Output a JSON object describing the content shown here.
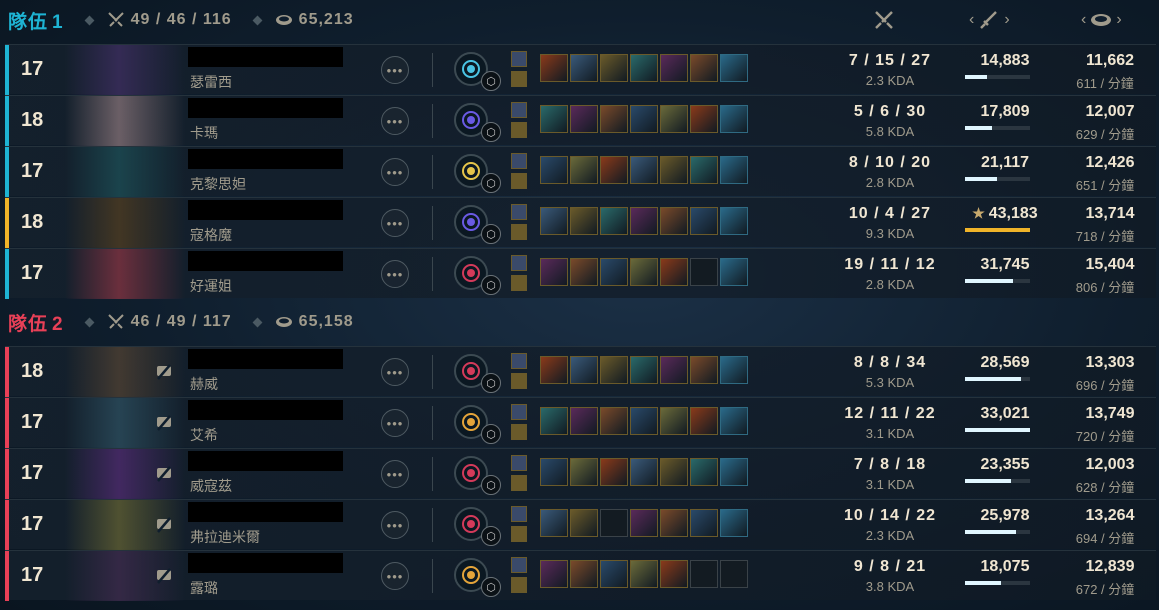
{
  "columns": {
    "kda_icon": "crossed-swords-icon",
    "damage_icon": "sword-icon",
    "gold_icon": "gold-coins-icon",
    "prev_arrow": "‹",
    "next_arrow": "›"
  },
  "colors": {
    "team1": "#1eb4d4",
    "team2": "#e84057",
    "highlight": "#f0b429",
    "damage_bar": "#e0f6ff"
  },
  "team1": {
    "label": "隊伍",
    "number": "1",
    "kills": "49 / 46 / 116",
    "gold": "65,213",
    "players": [
      {
        "level": "17",
        "champion": "瑟雷西",
        "kda": "7 / 15 / 27",
        "kda_ratio": "2.3 KDA",
        "damage": "14,883",
        "damage_fraction": 0.34,
        "gold": "11,662",
        "gpm": "611 / 分鐘",
        "keystone": "glacial-augment-icon",
        "secondary": "resolve-icon",
        "highlight": false,
        "portrait_color": "#3a2d5c",
        "items": [
          "item",
          "item",
          "item",
          "item",
          "item",
          "item",
          "trinket"
        ]
      },
      {
        "level": "18",
        "champion": "卡瑪",
        "kda": "5 / 6 / 30",
        "kda_ratio": "5.8 KDA",
        "damage": "17,809",
        "damage_fraction": 0.41,
        "gold": "12,007",
        "gpm": "629 / 分鐘",
        "keystone": "arcane-comet-icon",
        "secondary": "inspiration-icon",
        "highlight": false,
        "portrait_color": "#7a6a70",
        "items": [
          "item",
          "item",
          "item",
          "item",
          "item",
          "item",
          "trinket"
        ]
      },
      {
        "level": "17",
        "champion": "克黎思妲",
        "kda": "8 / 10 / 20",
        "kda_ratio": "2.8 KDA",
        "damage": "21,117",
        "damage_fraction": 0.49,
        "gold": "12,426",
        "gpm": "651 / 分鐘",
        "keystone": "lethal-tempo-icon",
        "secondary": "resolve-icon",
        "highlight": false,
        "portrait_color": "#1c4a52",
        "items": [
          "item",
          "item",
          "item",
          "item",
          "item",
          "item",
          "trinket"
        ]
      },
      {
        "level": "18",
        "champion": "寇格魔",
        "kda": "10 / 4 / 27",
        "kda_ratio": "9.3 KDA",
        "damage": "43,183",
        "damage_fraction": 1.0,
        "gold": "13,714",
        "gpm": "718 / 分鐘",
        "keystone": "arcane-comet-icon",
        "secondary": "inspiration-icon",
        "highlight": true,
        "portrait_color": "#4a3a22",
        "items": [
          "item",
          "item",
          "item",
          "item",
          "item",
          "item",
          "trinket"
        ]
      },
      {
        "level": "17",
        "champion": "好運姐",
        "kda": "19 / 11 / 12",
        "kda_ratio": "2.8 KDA",
        "damage": "31,745",
        "damage_fraction": 0.74,
        "gold": "15,404",
        "gpm": "806 / 分鐘",
        "keystone": "dark-harvest-icon",
        "secondary": "inspiration-icon",
        "highlight": false,
        "portrait_color": "#7a3240",
        "items": [
          "item",
          "item",
          "item",
          "item",
          "item",
          "empty",
          "trinket"
        ]
      }
    ]
  },
  "team2": {
    "label": "隊伍",
    "number": "2",
    "kills": "46 / 49 / 117",
    "gold": "65,158",
    "players": [
      {
        "level": "18",
        "champion": "赫威",
        "kda": "8 / 8 / 34",
        "kda_ratio": "5.3 KDA",
        "damage": "28,569",
        "damage_fraction": 0.86,
        "gold": "13,303",
        "gpm": "696 / 分鐘",
        "keystone": "dark-harvest-icon",
        "secondary": "inspiration-icon",
        "highlight": false,
        "portrait_color": "#4a3e32",
        "items": [
          "item",
          "item",
          "item",
          "item",
          "item",
          "item",
          "trinket"
        ]
      },
      {
        "level": "17",
        "champion": "艾希",
        "kda": "12 / 11 / 22",
        "kda_ratio": "3.1 KDA",
        "damage": "33,021",
        "damage_fraction": 1.0,
        "gold": "13,749",
        "gpm": "720 / 分鐘",
        "keystone": "conqueror-icon",
        "secondary": "sorcery-icon",
        "highlight": false,
        "portrait_color": "#2a4a5a",
        "items": [
          "item",
          "item",
          "item",
          "item",
          "item",
          "item",
          "trinket"
        ]
      },
      {
        "level": "17",
        "champion": "威寇茲",
        "kda": "7 / 8 / 18",
        "kda_ratio": "3.1 KDA",
        "damage": "23,355",
        "damage_fraction": 0.71,
        "gold": "12,003",
        "gpm": "628 / 分鐘",
        "keystone": "dark-harvest-icon",
        "secondary": "inspiration-icon",
        "highlight": false,
        "portrait_color": "#4a2a6a",
        "items": [
          "item",
          "item",
          "item",
          "item",
          "item",
          "item",
          "trinket"
        ]
      },
      {
        "level": "17",
        "champion": "弗拉迪米爾",
        "kda": "10 / 14 / 22",
        "kda_ratio": "2.3 KDA",
        "damage": "25,978",
        "damage_fraction": 0.79,
        "gold": "13,264",
        "gpm": "694 / 分鐘",
        "keystone": "dark-harvest-icon",
        "secondary": "inspiration-icon",
        "highlight": false,
        "portrait_color": "#5a5a32",
        "items": [
          "item",
          "item",
          "empty",
          "item",
          "item",
          "item",
          "trinket"
        ]
      },
      {
        "level": "17",
        "champion": "露璐",
        "kda": "9 / 8 / 21",
        "kda_ratio": "3.8 KDA",
        "damage": "18,075",
        "damage_fraction": 0.55,
        "gold": "12,839",
        "gpm": "672 / 分鐘",
        "keystone": "conqueror-icon",
        "secondary": "domination-icon",
        "highlight": false,
        "portrait_color": "#3a2a4a",
        "items": [
          "item",
          "item",
          "item",
          "item",
          "item",
          "empty",
          "empty"
        ]
      }
    ]
  }
}
